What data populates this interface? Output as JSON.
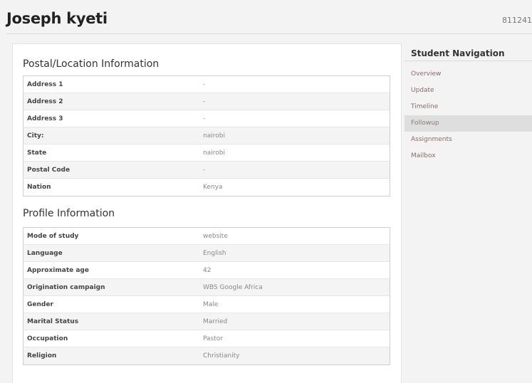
{
  "header": {
    "title": "Joseph kyeti",
    "student_id": "811241"
  },
  "postal": {
    "title": "Postal/Location Information",
    "rows": [
      {
        "label": "Address 1",
        "value": "-"
      },
      {
        "label": "Address 2",
        "value": "-"
      },
      {
        "label": "Address 3",
        "value": "-"
      },
      {
        "label": "City:",
        "value": "nairobi"
      },
      {
        "label": "State",
        "value": "nairobi"
      },
      {
        "label": "Postal Code",
        "value": "-"
      },
      {
        "label": "Nation",
        "value": "Kenya"
      }
    ]
  },
  "profile": {
    "title": "Profile Information",
    "rows": [
      {
        "label": "Mode of study",
        "value": "website"
      },
      {
        "label": "Language",
        "value": "English"
      },
      {
        "label": "Approximate age",
        "value": "42"
      },
      {
        "label": "Origination campaign",
        "value": "WBS Google Africa"
      },
      {
        "label": "Gender",
        "value": "Male"
      },
      {
        "label": "Marital Status",
        "value": "Married"
      },
      {
        "label": "Occupation",
        "value": "Pastor"
      },
      {
        "label": "Religion",
        "value": "Christianity"
      }
    ]
  },
  "nav": {
    "title": "Student Navigation",
    "active_index": 3,
    "items": [
      {
        "label": "Overview"
      },
      {
        "label": "Update"
      },
      {
        "label": "Timeline"
      },
      {
        "label": "Followup"
      },
      {
        "label": "Assignments"
      },
      {
        "label": "Mailbox"
      }
    ]
  }
}
